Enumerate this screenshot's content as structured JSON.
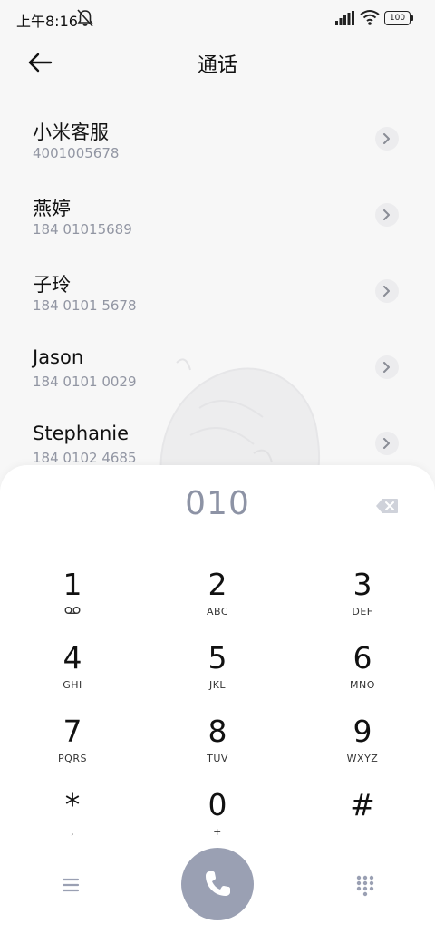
{
  "status_bar": {
    "time": "上午8:16",
    "mute_icon": "bell-mute-icon",
    "signal_icon": "signal-icon",
    "wifi_icon": "wifi-icon",
    "battery_level": "100"
  },
  "header": {
    "back_icon": "arrow-left-icon",
    "title": "通话"
  },
  "contacts": [
    {
      "name": "小米客服",
      "number": "4001005678"
    },
    {
      "name": "燕婷",
      "number": "184 01015689"
    },
    {
      "name": "子玲",
      "number": "184 0101 5678"
    },
    {
      "name": "Jason",
      "number": "184 0101 0029"
    },
    {
      "name": "Stephanie",
      "number": "184 0102 4685"
    }
  ],
  "dialer": {
    "input": "010",
    "backspace_icon": "backspace-icon",
    "keys": [
      {
        "digit": "1",
        "letters": "",
        "sub_icon": "voicemail-icon"
      },
      {
        "digit": "2",
        "letters": "ABC"
      },
      {
        "digit": "3",
        "letters": "DEF"
      },
      {
        "digit": "4",
        "letters": "GHI"
      },
      {
        "digit": "5",
        "letters": "JKL"
      },
      {
        "digit": "6",
        "letters": "MNO"
      },
      {
        "digit": "7",
        "letters": "PQRS"
      },
      {
        "digit": "8",
        "letters": "TUV"
      },
      {
        "digit": "9",
        "letters": "WXYZ"
      },
      {
        "digit": "*",
        "letters": ","
      },
      {
        "digit": "0",
        "letters": "+"
      },
      {
        "digit": "#",
        "letters": ""
      }
    ],
    "menu_icon": "menu-icon",
    "call_icon": "phone-icon",
    "keypad_icon": "dialpad-icon",
    "call_button_color": "#9aa0b3"
  }
}
